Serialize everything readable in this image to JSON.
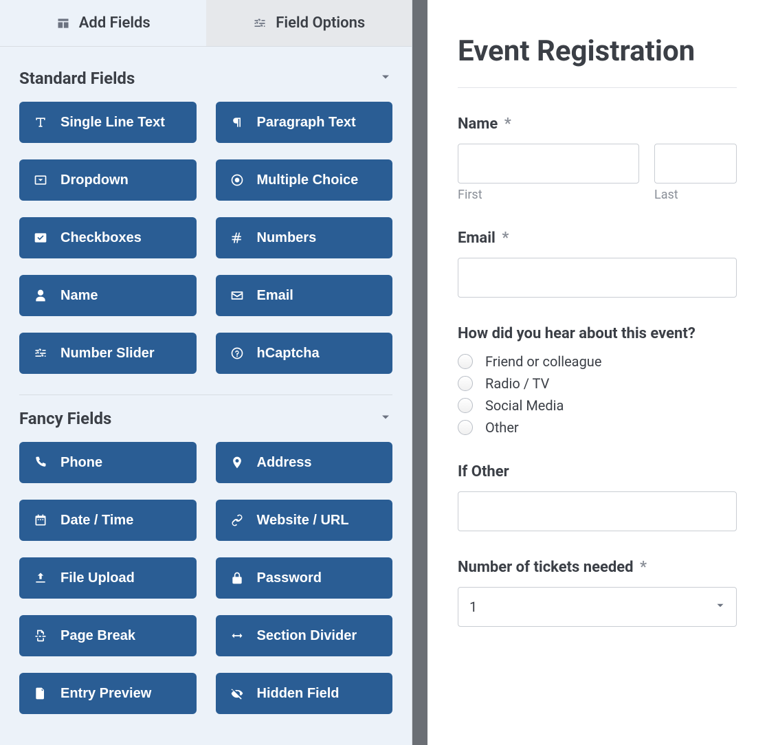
{
  "tabs": {
    "add_fields": "Add Fields",
    "field_options": "Field Options"
  },
  "sections": {
    "standard": {
      "title": "Standard Fields",
      "fields": [
        {
          "label": "Single Line Text",
          "icon": "text"
        },
        {
          "label": "Paragraph Text",
          "icon": "paragraph"
        },
        {
          "label": "Dropdown",
          "icon": "dropdown"
        },
        {
          "label": "Multiple Choice",
          "icon": "radio"
        },
        {
          "label": "Checkboxes",
          "icon": "checkbox"
        },
        {
          "label": "Numbers",
          "icon": "hash"
        },
        {
          "label": "Name",
          "icon": "user"
        },
        {
          "label": "Email",
          "icon": "mail"
        },
        {
          "label": "Number Slider",
          "icon": "sliders"
        },
        {
          "label": "hCaptcha",
          "icon": "help"
        }
      ]
    },
    "fancy": {
      "title": "Fancy Fields",
      "fields": [
        {
          "label": "Phone",
          "icon": "phone"
        },
        {
          "label": "Address",
          "icon": "pin"
        },
        {
          "label": "Date / Time",
          "icon": "calendar"
        },
        {
          "label": "Website / URL",
          "icon": "link"
        },
        {
          "label": "File Upload",
          "icon": "upload"
        },
        {
          "label": "Password",
          "icon": "lock"
        },
        {
          "label": "Page Break",
          "icon": "pagebreak"
        },
        {
          "label": "Section Divider",
          "icon": "arrows"
        },
        {
          "label": "Entry Preview",
          "icon": "doc"
        },
        {
          "label": "Hidden Field",
          "icon": "eyeoff"
        }
      ]
    }
  },
  "form": {
    "title": "Event Registration",
    "name_label": "Name",
    "first_sub": "First",
    "last_sub": "Last",
    "email_label": "Email",
    "source_label": "How did you hear about this event?",
    "source_options": [
      "Friend or colleague",
      "Radio / TV",
      "Social Media",
      "Other"
    ],
    "other_label": "If Other",
    "tickets_label": "Number of tickets needed",
    "tickets_value": "1",
    "required_mark": "*"
  }
}
